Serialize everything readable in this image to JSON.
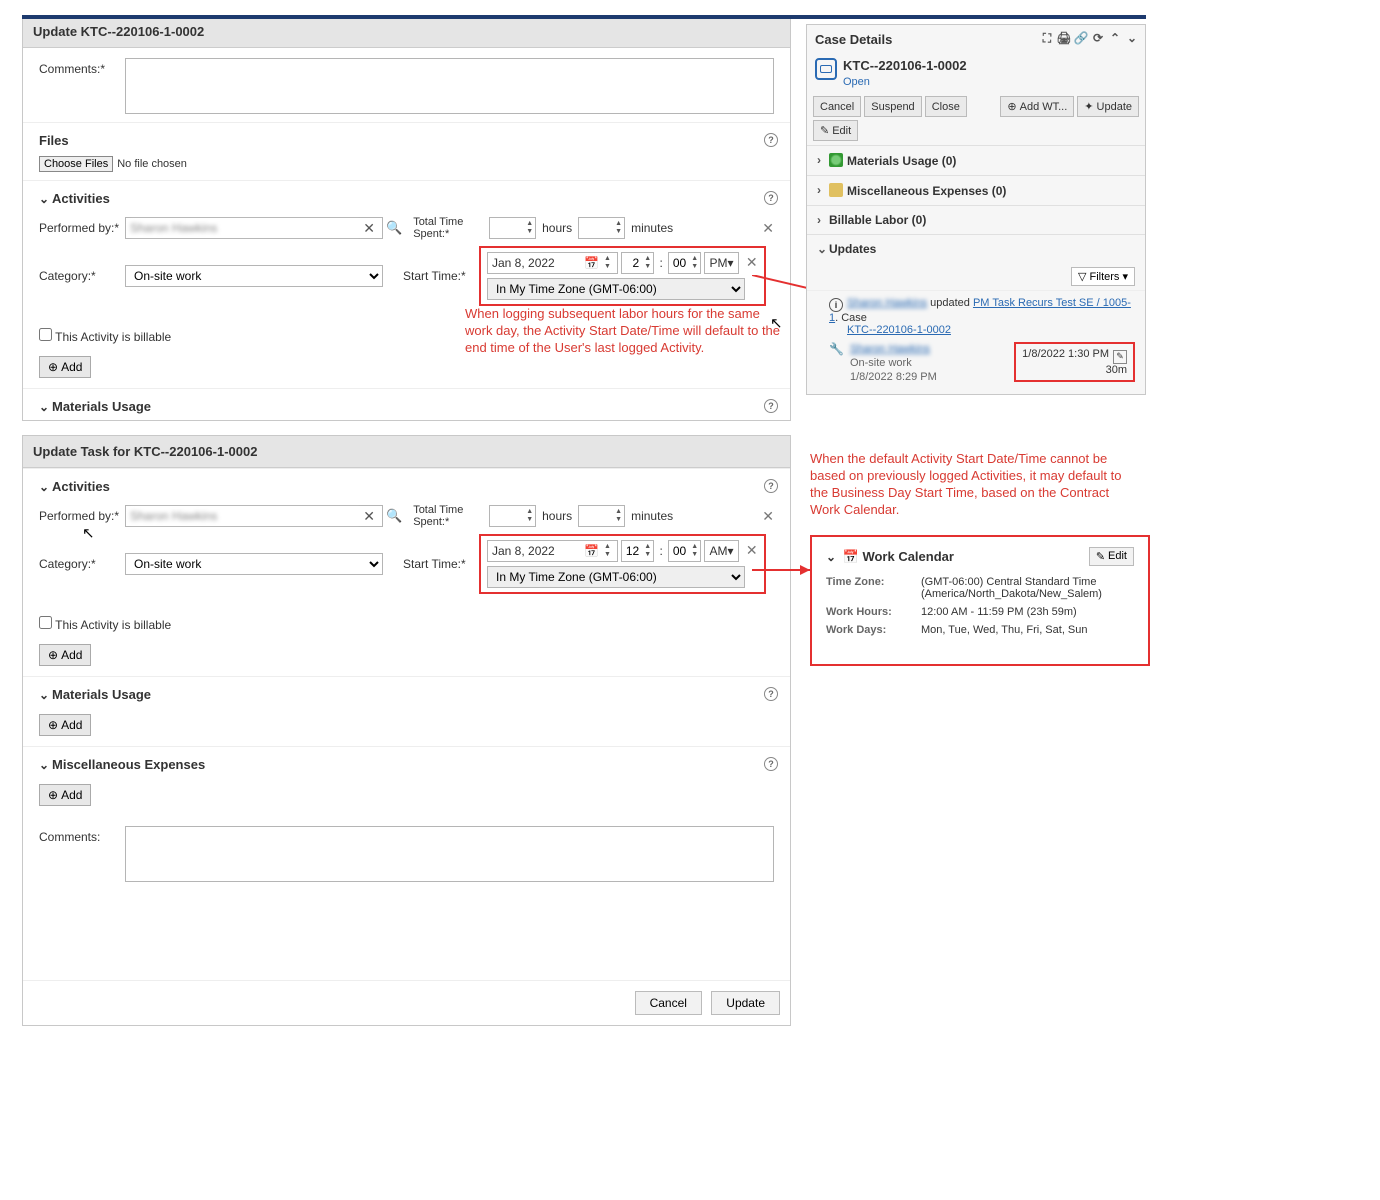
{
  "p1": {
    "title": "Update KTC--220106-1-0002",
    "comments_label": "Comments:*",
    "files_label": "Files",
    "choose_files": "Choose Files",
    "no_file": "No file chosen",
    "activities_label": "Activities",
    "performed_by": "Performed by:*",
    "category": "Category:*",
    "category_val": "On-site work",
    "total_time": "Total Time Spent:*",
    "hours": "hours",
    "minutes": "minutes",
    "start_time": "Start Time:*",
    "date": "Jan 8, 2022",
    "hh": "2",
    "mm": "00",
    "ampm": "PM",
    "tz": "In My Time Zone (GMT-06:00)",
    "billable": "This Activity is billable",
    "add": "Add",
    "materials": "Materials Usage"
  },
  "note1": "When logging subsequent labor hours for the same work day, the Activity Start Date/Time will default to the end time of the User's last logged Activity.",
  "cd": {
    "title": "Case Details",
    "caseid": "KTC--220106-1-0002",
    "status": "Open",
    "btns": {
      "cancel": "Cancel",
      "suspend": "Suspend",
      "close": "Close",
      "addwt": "Add WT...",
      "update": "Update",
      "edit": "Edit"
    },
    "acc": {
      "materials": "Materials Usage (0)",
      "misc": "Miscellaneous Expenses (0)",
      "billable": "Billable Labor (0)",
      "updates": "Updates"
    },
    "filters": "Filters",
    "upd_text1": " updated ",
    "upd_link1": "PM Task Recurs Test SE / 1005-1",
    "upd_text2": ". Case ",
    "upd_link2": "KTC--220106-1-0002",
    "actwork": "On-site work",
    "acttime": "1/8/2022 8:29 PM",
    "boxtime": "1/8/2022 1:30 PM",
    "boxdur": "30m"
  },
  "p2": {
    "title": "Update Task for KTC--220106-1-0002",
    "comments": "Comments:",
    "hh": "12",
    "mm": "00",
    "ampm": "AM",
    "exp": "Miscellaneous Expenses",
    "cancel": "Cancel",
    "update": "Update"
  },
  "note2": "When the default Activity Start Date/Time cannot be based on previously logged Activities, it may default to the Business Day Start Time, based on the Contract Work Calendar.",
  "wc": {
    "title": "Work Calendar",
    "edit": "Edit",
    "tz_k": "Time Zone:",
    "tz_v": "(GMT-06:00) Central Standard Time (America/North_Dakota/New_Salem)",
    "wh_k": "Work Hours:",
    "wh_v": "12:00 AM - 11:59 PM (23h 59m)",
    "wd_k": "Work Days:",
    "wd_v": "Mon, Tue, Wed, Thu, Fri, Sat, Sun"
  }
}
